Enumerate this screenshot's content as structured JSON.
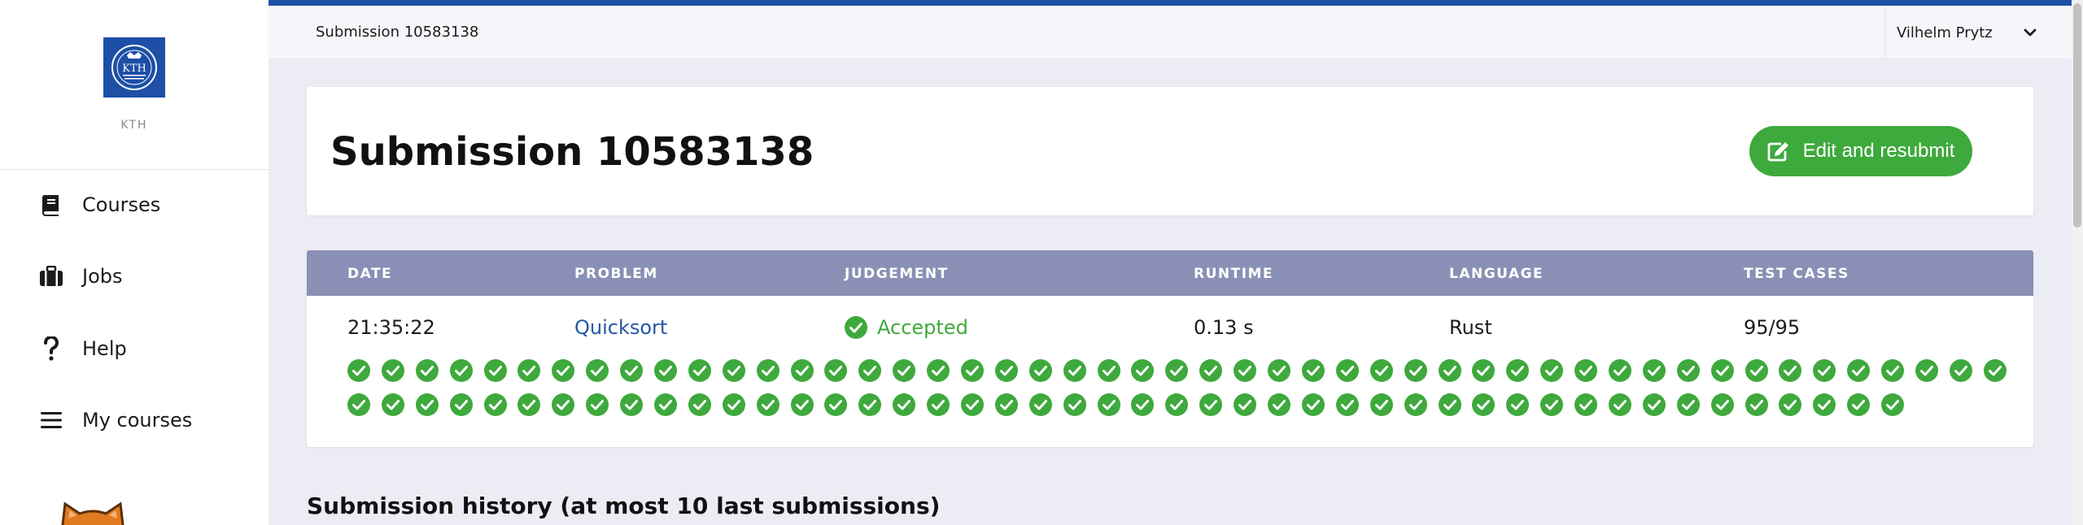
{
  "sidebar": {
    "logo_text": "KTH",
    "logo_caption": "KTH",
    "items": [
      {
        "label": "Courses",
        "icon": "book-icon"
      },
      {
        "label": "Jobs",
        "icon": "briefcase-icon"
      },
      {
        "label": "Help",
        "icon": "question-icon"
      },
      {
        "label": "My courses",
        "icon": "list-icon"
      }
    ]
  },
  "topbar": {
    "breadcrumb": "Submission 10583138",
    "user_name": "Vilhelm Prytz"
  },
  "header": {
    "title": "Submission 10583138",
    "resubmit_label": "Edit and resubmit"
  },
  "results": {
    "columns": [
      "DATE",
      "PROBLEM",
      "JUDGEMENT",
      "RUNTIME",
      "LANGUAGE",
      "TEST CASES"
    ],
    "row": {
      "date": "21:35:22",
      "problem": "Quicksort",
      "judgement": "Accepted",
      "runtime": "0.13 s",
      "language": "Rust",
      "test_cases": "95/95"
    },
    "test_case_results": {
      "passed": 95,
      "total": 95,
      "per_row": 49
    }
  },
  "history_title": "Submission history (at most 10 last submissions)",
  "colors": {
    "brand_blue": "#1d4fa6",
    "accept_green": "#3ea93c",
    "table_header": "#8a90b5",
    "link": "#2456a5"
  }
}
